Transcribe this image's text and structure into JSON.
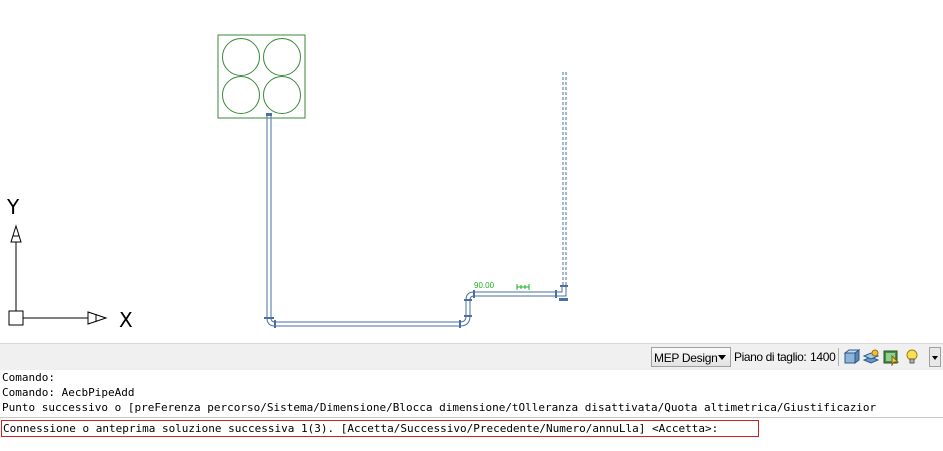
{
  "drawing": {
    "ucs_x_label": "X",
    "ucs_y_label": "Y",
    "dimension_label": "90.00",
    "colors": {
      "equipment": "#3a8a3a",
      "pipe": "#4a6fa0",
      "dimension": "#22b022",
      "ucs": "#000000"
    }
  },
  "statusbar": {
    "workspace": "MEP Design",
    "cut_plane_label": "Piano di taglio:",
    "cut_plane_value": "1400",
    "tray_icons": [
      "object-display-icon",
      "layer-key-icon",
      "annotation-scale-icon",
      "lightbulb-icon"
    ]
  },
  "command_line": {
    "history": [
      "Comando:",
      "Comando: AecbPipeAdd",
      "Punto successivo o [preFerenza percorso/Sistema/Dimensione/Blocca dimensione/tOlleranza disattivata/Quota altimetrica/Giustificazior"
    ],
    "prompt": "Connessione o anteprima soluzione successiva 1(3). [Accetta/Successivo/Precedente/Numero/annuLla] <Accetta>:"
  }
}
